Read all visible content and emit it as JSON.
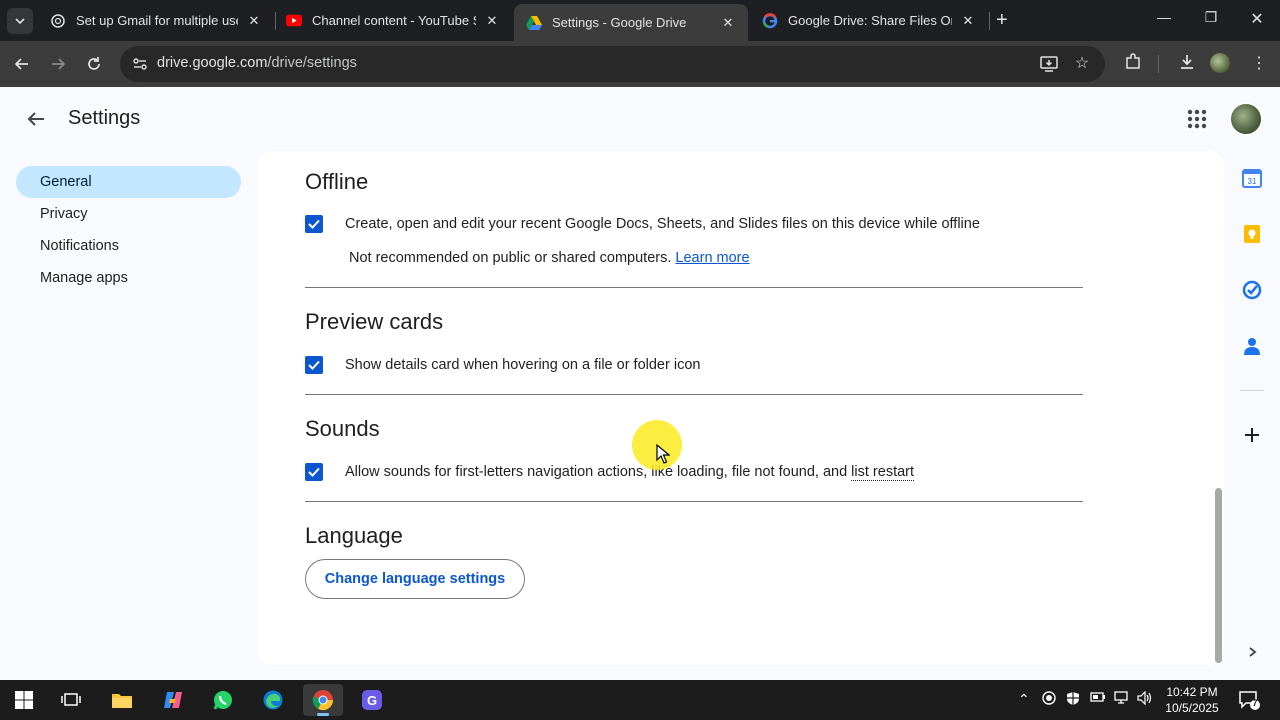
{
  "browser": {
    "tabs": [
      {
        "title": "Set up Gmail for multiple users",
        "favicon": "openai-icon",
        "active": false
      },
      {
        "title": "Channel content - YouTube Studio",
        "favicon": "youtube-icon",
        "active": false
      },
      {
        "title": "Settings - Google Drive",
        "favicon": "google-drive-icon",
        "active": true
      },
      {
        "title": "Google Drive: Share Files Online",
        "favicon": "google-icon",
        "active": false
      }
    ],
    "new_tab_label": "+",
    "url_host": "drive.google.com",
    "url_path": "/drive/settings"
  },
  "page": {
    "title": "Settings",
    "nav": [
      {
        "label": "General",
        "active": true
      },
      {
        "label": "Privacy",
        "active": false
      },
      {
        "label": "Notifications",
        "active": false
      },
      {
        "label": "Manage apps",
        "active": false
      }
    ],
    "sections": {
      "offline": {
        "title": "Offline",
        "option": "Create, open and edit your recent Google Docs, Sheets, and Slides files on this device while offline",
        "note": "Not recommended on public or shared computers.",
        "link": "Learn more",
        "checked": true
      },
      "preview": {
        "title": "Preview cards",
        "option": "Show details card when hovering on a file or folder icon",
        "checked": true
      },
      "sounds": {
        "title": "Sounds",
        "option_prefix": "Allow sounds for first-letters navigation actions, like loading, file not found, and ",
        "option_link": "list restart",
        "checked": true
      },
      "language": {
        "title": "Language",
        "button": "Change language settings"
      }
    }
  },
  "taskbar": {
    "clock_time": "10:42 PM",
    "clock_date": "10/5/2025",
    "notification_count": "7"
  },
  "colors": {
    "accent": "#0b57d0",
    "nav_active": "#c2e7ff",
    "browser_frame": "#1e1f22",
    "toolbar": "#3c3c3c"
  }
}
